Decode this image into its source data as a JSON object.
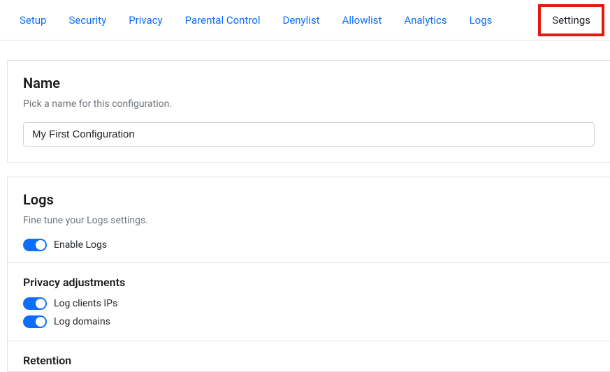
{
  "tabs": {
    "setup": "Setup",
    "security": "Security",
    "privacy": "Privacy",
    "parental": "Parental Control",
    "denylist": "Denylist",
    "allowlist": "Allowlist",
    "analytics": "Analytics",
    "logs": "Logs",
    "settings": "Settings"
  },
  "name_section": {
    "title": "Name",
    "desc": "Pick a name for this configuration.",
    "value": "My First Configuration"
  },
  "logs_section": {
    "title": "Logs",
    "desc": "Fine tune your Logs settings.",
    "enable_label": "Enable Logs",
    "privacy_title": "Privacy adjustments",
    "log_clients_label": "Log clients IPs",
    "log_domains_label": "Log domains",
    "retention_title": "Retention"
  }
}
